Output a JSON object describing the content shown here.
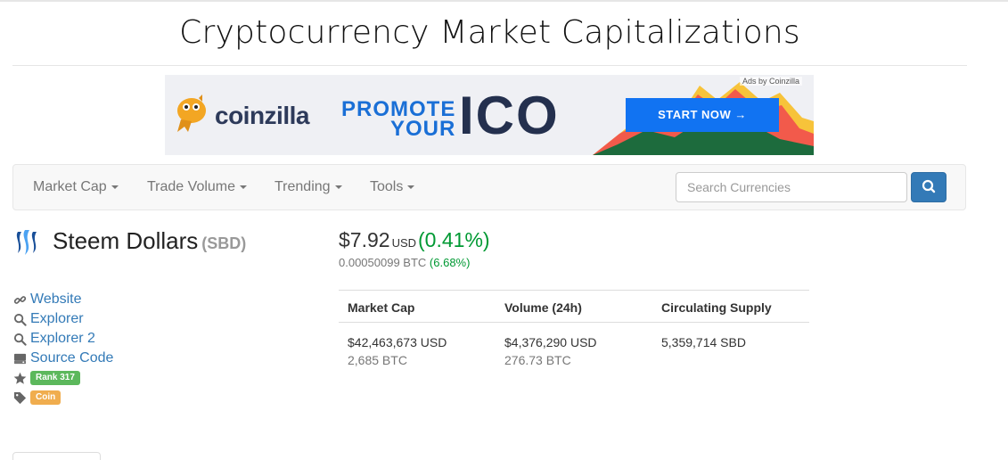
{
  "page": {
    "title": "Cryptocurrency Market Capitalizations"
  },
  "ad": {
    "brand": "coinzilla",
    "promote_line1": "PROMOTE",
    "promote_line2": "YOUR",
    "headline": "ICO",
    "cta": "START NOW →",
    "tag": "Ads by Coinzilla",
    "colors": {
      "cta": "#1173f2",
      "brand_text": "#2d3a5a",
      "promote": "#1a6fd6"
    }
  },
  "nav": {
    "items": [
      "Market Cap",
      "Trade Volume",
      "Trending",
      "Tools"
    ],
    "search_placeholder": "Search Currencies",
    "search_icon": "search-icon"
  },
  "coin": {
    "name": "Steem Dollars",
    "symbol": "(SBD)",
    "logo_icon": "steem-logo-icon",
    "price": "$7.92",
    "price_unit": "USD",
    "price_change": "(0.41%)",
    "price_btc": "0.00050099 BTC",
    "price_btc_change": "(6.68%)",
    "change_color": "#009933"
  },
  "links": {
    "website": "Website",
    "explorer": "Explorer",
    "explorer2": "Explorer 2",
    "source_code": "Source Code",
    "rank_badge": "Rank 317",
    "type_badge": "Coin"
  },
  "stats": {
    "headers": [
      "Market Cap",
      "Volume (24h)",
      "Circulating Supply"
    ],
    "market_cap_usd": "$42,463,673 USD",
    "market_cap_btc": "2,685 BTC",
    "volume_usd": "$4,376,290 USD",
    "volume_btc": "276.73 BTC",
    "supply": "5,359,714 SBD"
  }
}
